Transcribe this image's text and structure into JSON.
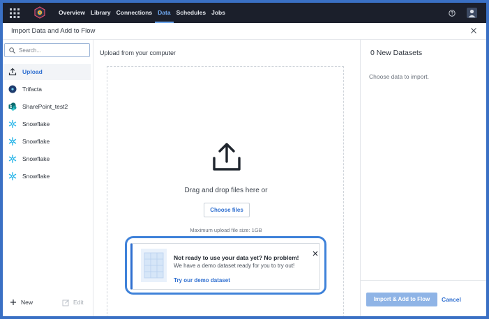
{
  "topnav": {
    "links": [
      "Overview",
      "Library",
      "Connections",
      "Data",
      "Schedules",
      "Jobs"
    ],
    "active": "Data"
  },
  "dialog": {
    "title": "Import Data and Add to Flow"
  },
  "sidebar": {
    "search_placeholder": "Search...",
    "items": [
      {
        "label": "Upload",
        "icon": "upload-icon",
        "selected": true
      },
      {
        "label": "Trifacta",
        "icon": "trifacta-icon",
        "selected": false
      },
      {
        "label": "SharePoint_test2",
        "icon": "sharepoint-icon",
        "selected": false
      },
      {
        "label": "Snowflake",
        "icon": "snowflake-icon",
        "selected": false
      },
      {
        "label": "Snowflake",
        "icon": "snowflake-icon",
        "selected": false
      },
      {
        "label": "Snowflake",
        "icon": "snowflake-icon",
        "selected": false
      },
      {
        "label": "Snowflake",
        "icon": "snowflake-icon",
        "selected": false
      }
    ],
    "new_label": "New",
    "edit_label": "Edit"
  },
  "center": {
    "title": "Upload from your computer",
    "drag_text": "Drag and drop files here or",
    "choose_label": "Choose files",
    "max_text": "Maximum upload file size: 1GB",
    "demo": {
      "title": "Not ready to use your data yet? No problem!",
      "subtitle": "We have a demo dataset ready for you to try out!",
      "link": "Try our demo dataset"
    }
  },
  "right": {
    "title": "0 New Datasets",
    "message": "Choose data to import.",
    "import_label": "Import & Add to Flow",
    "cancel_label": "Cancel"
  },
  "colors": {
    "nav_bg": "#1b1f2b",
    "accent": "#2f6fd0",
    "highlight": "#3f82d9"
  }
}
